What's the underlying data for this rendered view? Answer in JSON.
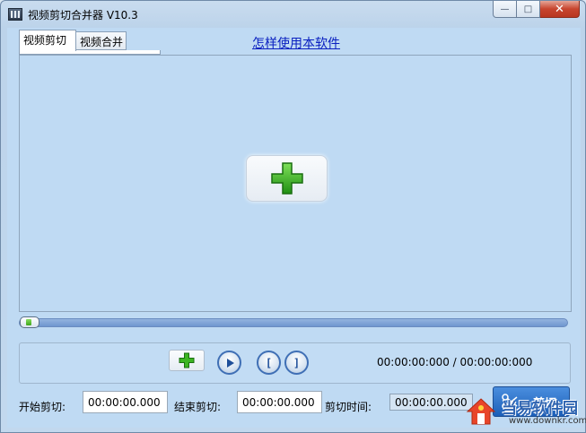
{
  "window": {
    "title": "视频剪切合并器 V10.3",
    "controls": {
      "minimize": "—",
      "maximize": "□",
      "close": "✕"
    }
  },
  "tabs": [
    {
      "label": "视频剪切",
      "active": true
    },
    {
      "label": "视频合并",
      "active": false
    }
  ],
  "help_link": "怎样使用本软件",
  "preview": {
    "add_icon": "green-plus-icon"
  },
  "slider": {
    "position": 0.0
  },
  "controls": {
    "add_icon": "green-plus-icon",
    "play_icon": "play-icon",
    "mark_in_label": "[",
    "mark_out_label": "]",
    "time_readout": "00:00:00:000 / 00:00:00:000"
  },
  "bottom": {
    "start_label": "开始剪切:",
    "start_value": "00:00:00.000",
    "end_label": "结束剪切:",
    "end_value": "00:00:00.000",
    "duration_label": "剪切时间:",
    "duration_value": "00:00:00.000",
    "cut_button": "剪切"
  },
  "watermark": {
    "text": "当易软件园",
    "url": "www.downkr.com"
  },
  "colors": {
    "accent": "#1c5fb8",
    "preview_bg": "#bfdaf3",
    "link": "#0a20c0",
    "add_green": "#2fa81a"
  }
}
